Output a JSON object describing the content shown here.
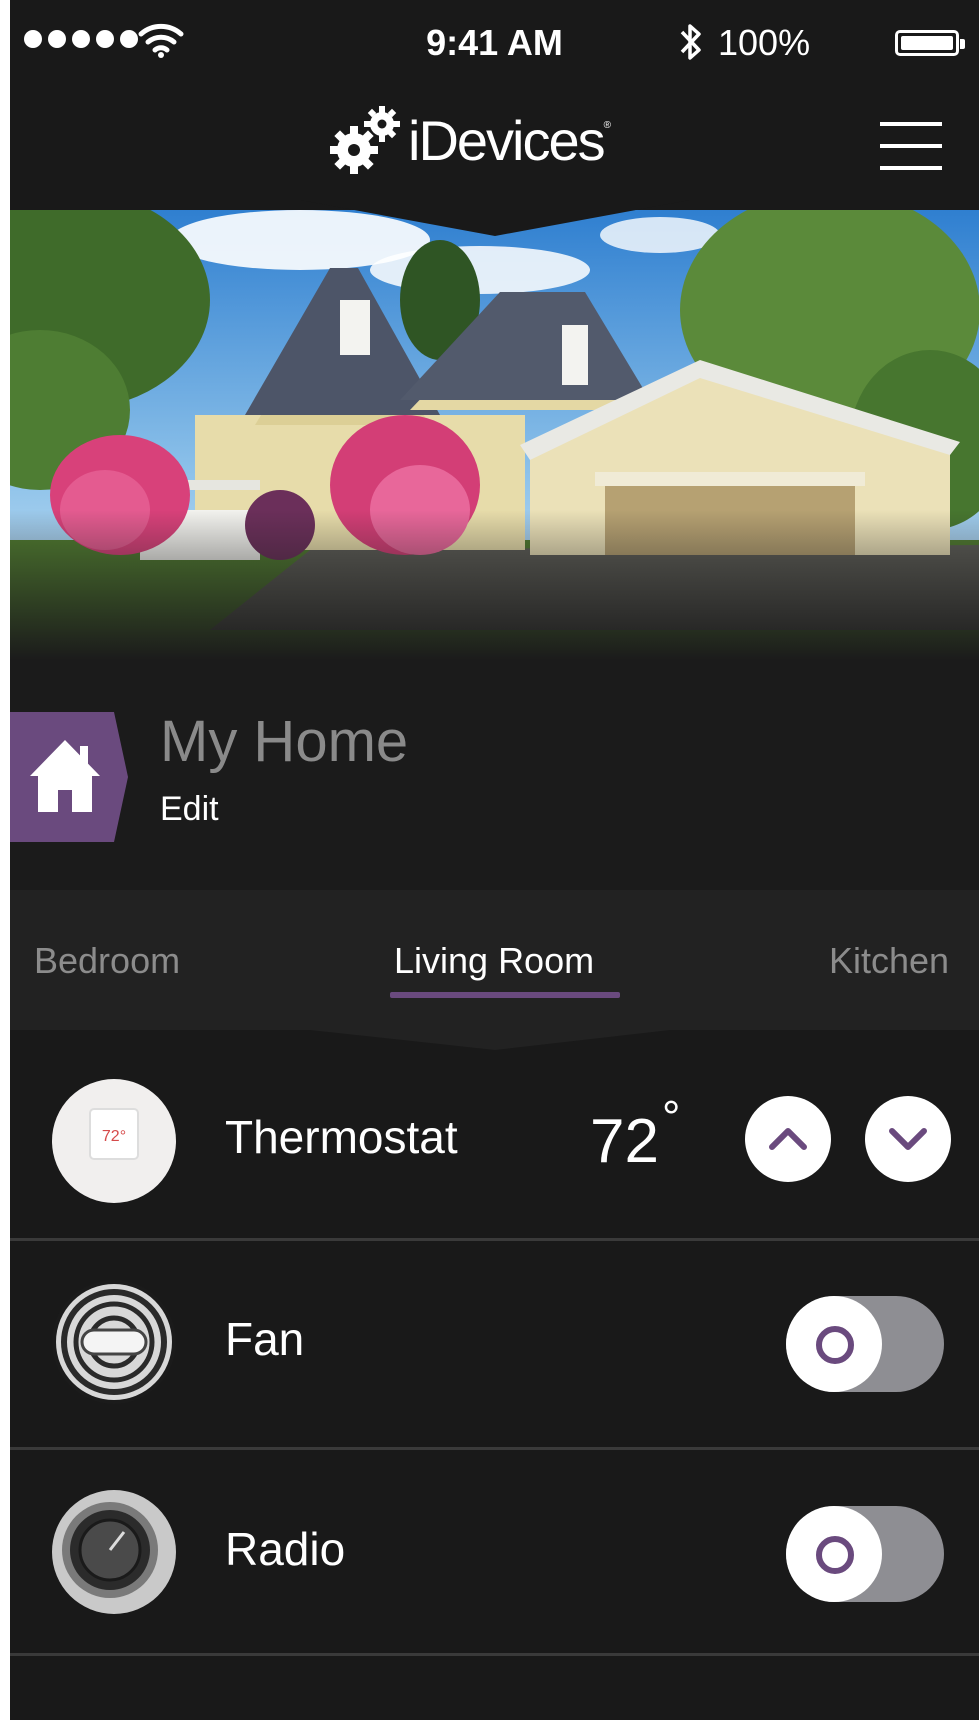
{
  "status_bar": {
    "time": "9:41 AM",
    "battery": "100%",
    "signal_dots": 5
  },
  "header": {
    "logo_text": "iDevices",
    "logo_mark": "®"
  },
  "home": {
    "title": "My Home",
    "edit_label": "Edit"
  },
  "tabs": [
    {
      "label": "Bedroom",
      "selected": false
    },
    {
      "label": "Living Room",
      "selected": true
    },
    {
      "label": "Kitchen",
      "selected": false
    }
  ],
  "devices": [
    {
      "name": "Thermostat",
      "temperature": "72",
      "degree": "°",
      "thumb_display": "72°"
    },
    {
      "name": "Fan",
      "switch_on": false
    },
    {
      "name": "Radio",
      "switch_on": false
    }
  ],
  "colors": {
    "accent": "#6a4a7e",
    "background": "#191919",
    "toggle_track": "#8e8e93"
  },
  "icons": {
    "logo": "gears-icon",
    "menu": "hamburger-icon",
    "home": "house-icon",
    "up": "chevron-up-icon",
    "down": "chevron-down-icon"
  }
}
